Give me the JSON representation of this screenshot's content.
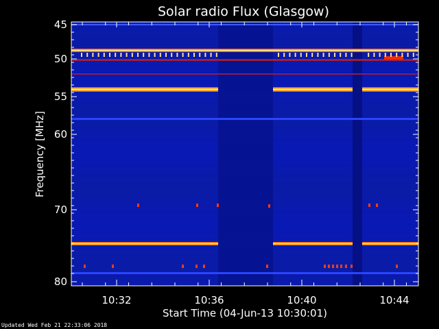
{
  "footer": "Updated Wed Feb 21 22:33:06 2018",
  "chart_data": {
    "type": "heatmap",
    "title": "Solar radio Flux (Glasgow)",
    "xlabel": "Start Time (04-Jun-13 10:30:01)",
    "ylabel": "Frequency [MHz]",
    "x_ticks": [
      "10:32",
      "10:36",
      "10:40",
      "10:44"
    ],
    "y_ticks": [
      "45",
      "50",
      "55",
      "60",
      "70",
      "80"
    ],
    "colors": {
      "background": "#000000",
      "base": "#0a1aa8",
      "hot": "#ff2a00",
      "bright": "#ffff66",
      "faint": "#1e3dff"
    }
  }
}
